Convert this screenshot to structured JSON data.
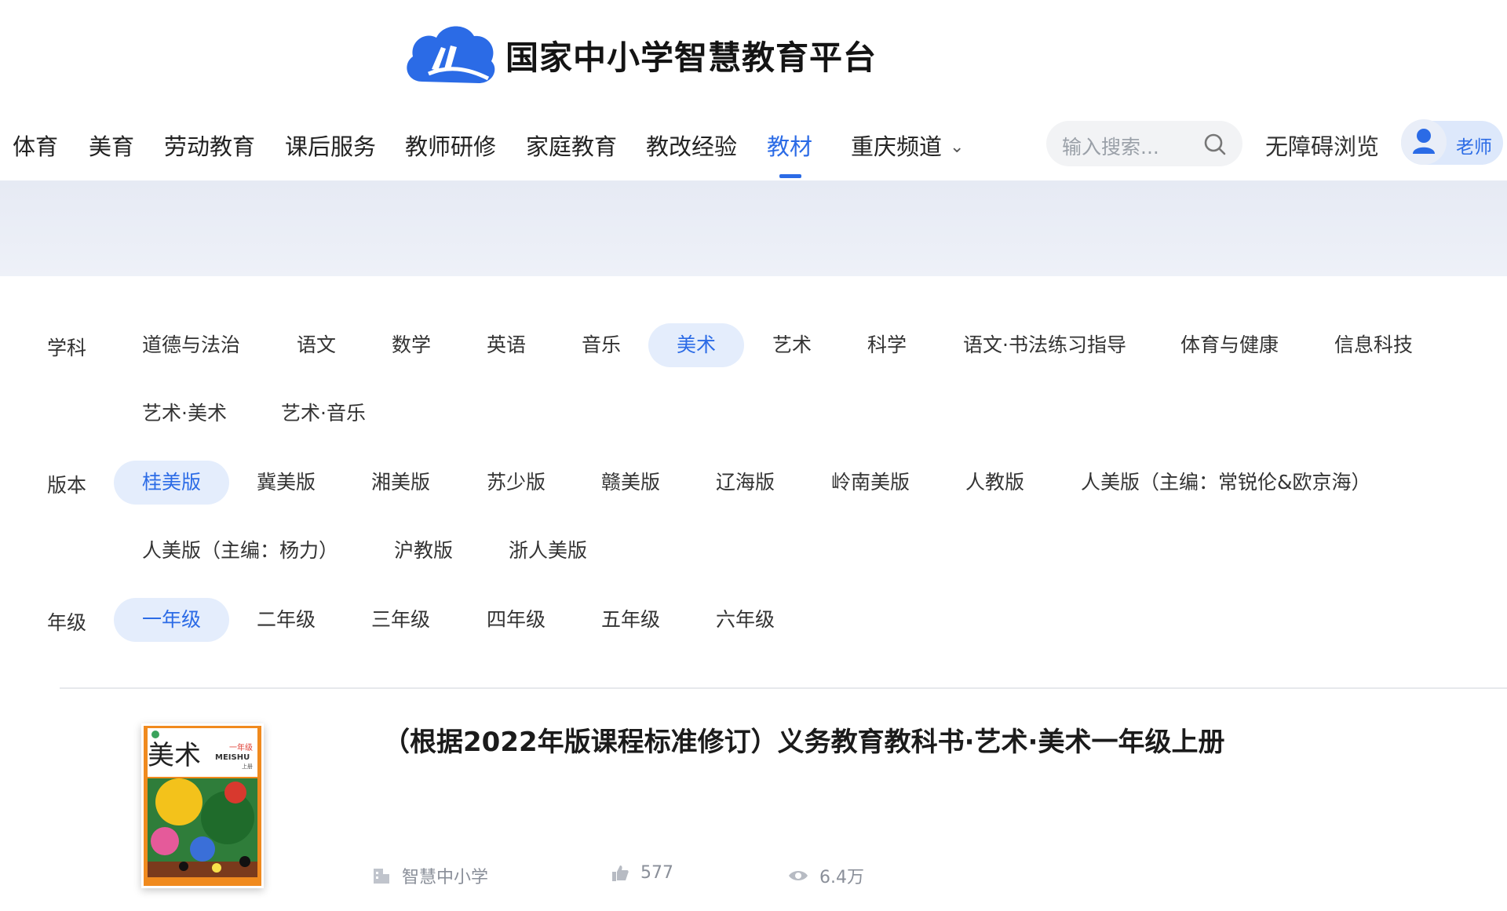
{
  "header": {
    "site_title": "国家中小学智慧教育平台"
  },
  "nav": {
    "items": [
      {
        "label": "体育"
      },
      {
        "label": "美育"
      },
      {
        "label": "劳动教育"
      },
      {
        "label": "课后服务"
      },
      {
        "label": "教师研修"
      },
      {
        "label": "家庭教育"
      },
      {
        "label": "教改经验"
      },
      {
        "label": "教材"
      },
      {
        "label": "重庆频道"
      }
    ],
    "active": "教材",
    "search_placeholder": "输入搜索...",
    "accessibility": "无障碍浏览",
    "user_role": "老师"
  },
  "filters": {
    "subject_label": "学科",
    "subjects": [
      "道德与法治",
      "语文",
      "数学",
      "英语",
      "音乐",
      "美术",
      "艺术",
      "科学",
      "语文·书法练习指导",
      "体育与健康",
      "信息科技",
      "艺术·美术",
      "艺术·音乐"
    ],
    "subject_selected": "美术",
    "edition_label": "版本",
    "editions": [
      "桂美版",
      "冀美版",
      "湘美版",
      "苏少版",
      "赣美版",
      "辽海版",
      "岭南美版",
      "人教版",
      "人美版（主编：常锐伦&欧京海）",
      "人美版（主编：杨力）",
      "沪教版",
      "浙人美版"
    ],
    "edition_selected": "桂美版",
    "grade_label": "年级",
    "grades": [
      "一年级",
      "二年级",
      "三年级",
      "四年级",
      "五年级",
      "六年级"
    ],
    "grade_selected": "一年级"
  },
  "book": {
    "title": "（根据2022年版课程标准修订）义务教育教科书·艺术·美术一年级上册",
    "publisher": "智慧中小学",
    "likes": "577",
    "views": "6.4万",
    "cover_text": {
      "main": "美术",
      "grade": "一年级",
      "pinyin": "MEISHU",
      "volume": "上册"
    }
  },
  "colors": {
    "accent": "#2b6be6",
    "chip_selected_bg": "#e4edfc"
  }
}
